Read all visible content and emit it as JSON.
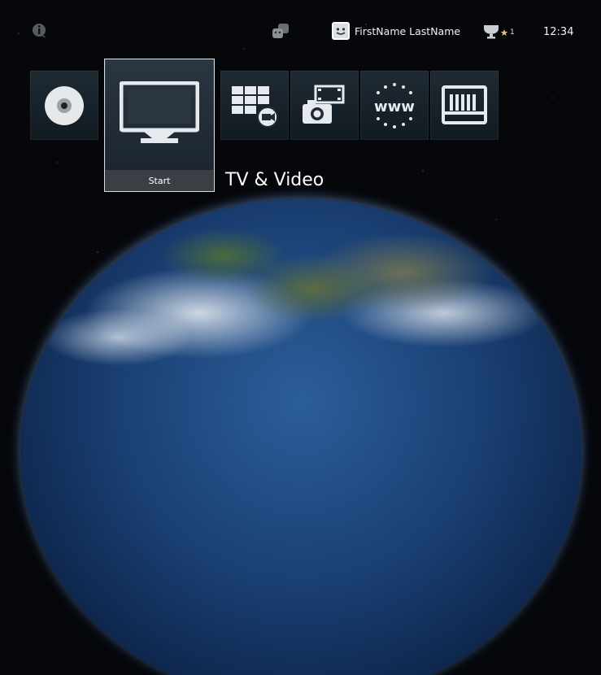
{
  "status_bar": {
    "notification_icon": "info-bubble-icon",
    "friends_icon": "friends-icon",
    "user_name": "FirstName LastName",
    "trophy_icon": "trophy-icon",
    "trophy_count": "1",
    "clock": "12:34"
  },
  "tiles": [
    {
      "icon": "disc-icon"
    },
    {
      "icon": "tv-icon",
      "label": "Start",
      "selected": true
    },
    {
      "icon": "apps-grid-icon"
    },
    {
      "icon": "camera-icon"
    },
    {
      "icon": "www-browser-icon"
    },
    {
      "icon": "library-icon"
    }
  ],
  "main": {
    "selected_title": "TV & Video",
    "start_label": "Start"
  },
  "colors": {
    "background": "#05070b",
    "tile": "#1f2a33",
    "selected_border": "#d6dde3",
    "start_bar": "#3a3f45"
  }
}
